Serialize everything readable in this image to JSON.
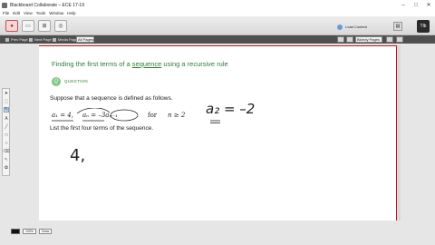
{
  "window": {
    "title": "Blackboard Collaborate – ECE 17-19",
    "minimize": "–",
    "maximize": "□",
    "close": "✕"
  },
  "menu": [
    "File",
    "Edit",
    "View",
    "Tools",
    "Window",
    "Help"
  ],
  "toolbar": {
    "load_content": "Load Content",
    "logo_text": "Tlb"
  },
  "pagebar": {
    "prev_page": "Prev Page",
    "next_page": "Next Page",
    "media_page": "Media Page",
    "page_select": "All Pages",
    "tool_select": "Bkbrdy Pages"
  },
  "palette": {
    "tools": [
      "cursor-icon",
      "select-icon",
      "pen-icon",
      "text-icon",
      "line-icon",
      "rect-icon",
      "ellipse-icon",
      "eraser-icon",
      "pointer-icon",
      "clipart-icon"
    ]
  },
  "question": {
    "title_pre": "Finding the first terms of a ",
    "title_kw": "sequence",
    "title_post": " using a recursive rule",
    "badge": "Q",
    "label": "QUESTION",
    "prompt": "Suppose that a sequence is defined as follows.",
    "formula_a1": "a₁ = 4,",
    "formula_an": "aₙ = –3aₙ₋₁",
    "formula_for": "for",
    "formula_cond": "n ≥ 2",
    "list": "List the first four terms of the sequence."
  },
  "handwriting": {
    "a2": "a₂ = –2",
    "term1": "4,"
  },
  "status": {
    "zoom": "100%",
    "mode": "Draw"
  },
  "colors": {
    "title_green": "#2e7d32",
    "board_border": "#b71c1c",
    "ink": "#222222"
  }
}
